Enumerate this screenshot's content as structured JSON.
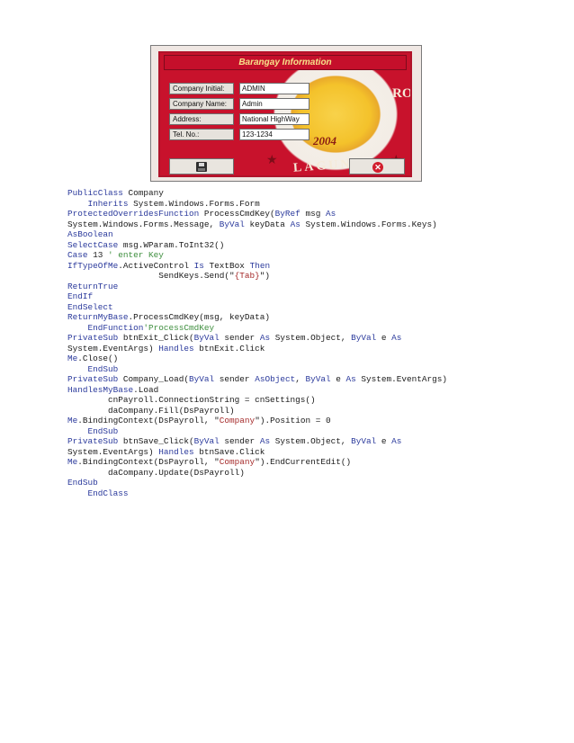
{
  "form": {
    "title": "Barangay Information",
    "fields": [
      {
        "label": "Company Initial:",
        "value": "ADMIN"
      },
      {
        "label": "Company Name:",
        "value": "Admin"
      },
      {
        "label": "Address:",
        "value": "National HighWay"
      },
      {
        "label": "Tel. No.:",
        "value": "123-1234"
      }
    ],
    "seal": {
      "year": "2004",
      "bottom_text": "LAGUNA",
      "right_text": "RO",
      "star": "★"
    },
    "colors": {
      "title_bar": "#c50f2b",
      "border": "#b0132a",
      "title_text": "#f7e28a"
    }
  },
  "code": [
    [
      {
        "t": "PublicClass",
        "c": "kw"
      },
      {
        "t": " Company"
      }
    ],
    [
      {
        "t": "    "
      },
      {
        "t": "Inherits",
        "c": "kw"
      },
      {
        "t": " System.Windows.Forms.Form"
      }
    ],
    [
      {
        "t": "ProtectedOverridesFunction",
        "c": "kw"
      },
      {
        "t": " ProcessCmdKey("
      },
      {
        "t": "ByRef",
        "c": "kw"
      },
      {
        "t": " msg "
      },
      {
        "t": "As",
        "c": "kw"
      }
    ],
    [
      {
        "t": "System.Windows.Forms.Message, "
      },
      {
        "t": "ByVal",
        "c": "kw"
      },
      {
        "t": " keyData "
      },
      {
        "t": "As",
        "c": "kw"
      },
      {
        "t": " System.Windows.Forms.Keys)"
      }
    ],
    [
      {
        "t": "AsBoolean",
        "c": "kw"
      }
    ],
    [
      {
        "t": "SelectCase",
        "c": "kw"
      },
      {
        "t": " msg.WParam.ToInt32()"
      }
    ],
    [
      {
        "t": "Case",
        "c": "kw"
      },
      {
        "t": " 13 "
      },
      {
        "t": "' enter Key",
        "c": "cmt"
      }
    ],
    [
      {
        "t": "IfTypeOfMe",
        "c": "kw"
      },
      {
        "t": ".ActiveControl "
      },
      {
        "t": "Is",
        "c": "kw"
      },
      {
        "t": " TextBox "
      },
      {
        "t": "Then",
        "c": "kw"
      }
    ],
    [
      {
        "t": "                  SendKeys.Send(\""
      },
      {
        "t": "{Tab}",
        "c": "str"
      },
      {
        "t": "\")"
      }
    ],
    [
      {
        "t": "ReturnTrue",
        "c": "kw"
      }
    ],
    [
      {
        "t": "EndIf",
        "c": "kw"
      }
    ],
    [
      {
        "t": "EndSelect",
        "c": "kw"
      }
    ],
    [
      {
        "t": "ReturnMyBase",
        "c": "kw"
      },
      {
        "t": ".ProcessCmdKey(msg, keyData)"
      }
    ],
    [
      {
        "t": "    "
      },
      {
        "t": "EndFunction",
        "c": "kw"
      },
      {
        "t": "'ProcessCmdKey",
        "c": "cmt"
      }
    ],
    [
      {
        "t": "PrivateSub",
        "c": "kw"
      },
      {
        "t": " btnExit_Click("
      },
      {
        "t": "ByVal",
        "c": "kw"
      },
      {
        "t": " sender "
      },
      {
        "t": "As",
        "c": "kw"
      },
      {
        "t": " System.Object, "
      },
      {
        "t": "ByVal",
        "c": "kw"
      },
      {
        "t": " e "
      },
      {
        "t": "As",
        "c": "kw"
      }
    ],
    [
      {
        "t": "System.EventArgs) "
      },
      {
        "t": "Handles",
        "c": "kw"
      },
      {
        "t": " btnExit.Click"
      }
    ],
    [
      {
        "t": "Me",
        "c": "kw"
      },
      {
        "t": ".Close()"
      }
    ],
    [
      {
        "t": "    "
      },
      {
        "t": "EndSub",
        "c": "kw"
      }
    ],
    [
      {
        "t": "PrivateSub",
        "c": "kw"
      },
      {
        "t": " Company_Load("
      },
      {
        "t": "ByVal",
        "c": "kw"
      },
      {
        "t": " sender "
      },
      {
        "t": "AsObject",
        "c": "kw"
      },
      {
        "t": ", "
      },
      {
        "t": "ByVal",
        "c": "kw"
      },
      {
        "t": " e "
      },
      {
        "t": "As",
        "c": "kw"
      },
      {
        "t": " System.EventArgs)"
      }
    ],
    [
      {
        "t": "HandlesMyBase",
        "c": "kw"
      },
      {
        "t": ".Load"
      }
    ],
    [
      {
        "t": "        cnPayroll.ConnectionString = cnSettings()"
      }
    ],
    [
      {
        "t": "        daCompany.Fill(DsPayroll)"
      }
    ],
    [
      {
        "t": "Me",
        "c": "kw"
      },
      {
        "t": ".BindingContext(DsPayroll, \""
      },
      {
        "t": "Company",
        "c": "str"
      },
      {
        "t": "\").Position = 0"
      }
    ],
    [
      {
        "t": "    "
      },
      {
        "t": "EndSub",
        "c": "kw"
      }
    ],
    [
      {
        "t": "PrivateSub",
        "c": "kw"
      },
      {
        "t": " btnSave_Click("
      },
      {
        "t": "ByVal",
        "c": "kw"
      },
      {
        "t": " sender "
      },
      {
        "t": "As",
        "c": "kw"
      },
      {
        "t": " System.Object, "
      },
      {
        "t": "ByVal",
        "c": "kw"
      },
      {
        "t": " e "
      },
      {
        "t": "As",
        "c": "kw"
      }
    ],
    [
      {
        "t": "System.EventArgs) "
      },
      {
        "t": "Handles",
        "c": "kw"
      },
      {
        "t": " btnSave.Click"
      }
    ],
    [
      {
        "t": "Me",
        "c": "kw"
      },
      {
        "t": ".BindingContext(DsPayroll, \""
      },
      {
        "t": "Company",
        "c": "str"
      },
      {
        "t": "\").EndCurrentEdit()"
      }
    ],
    [
      {
        "t": "        daCompany.Update(DsPayroll)"
      }
    ],
    [
      {
        "t": "EndSub",
        "c": "kw"
      }
    ],
    [
      {
        "t": "    "
      },
      {
        "t": "EndClass",
        "c": "kw"
      }
    ]
  ]
}
